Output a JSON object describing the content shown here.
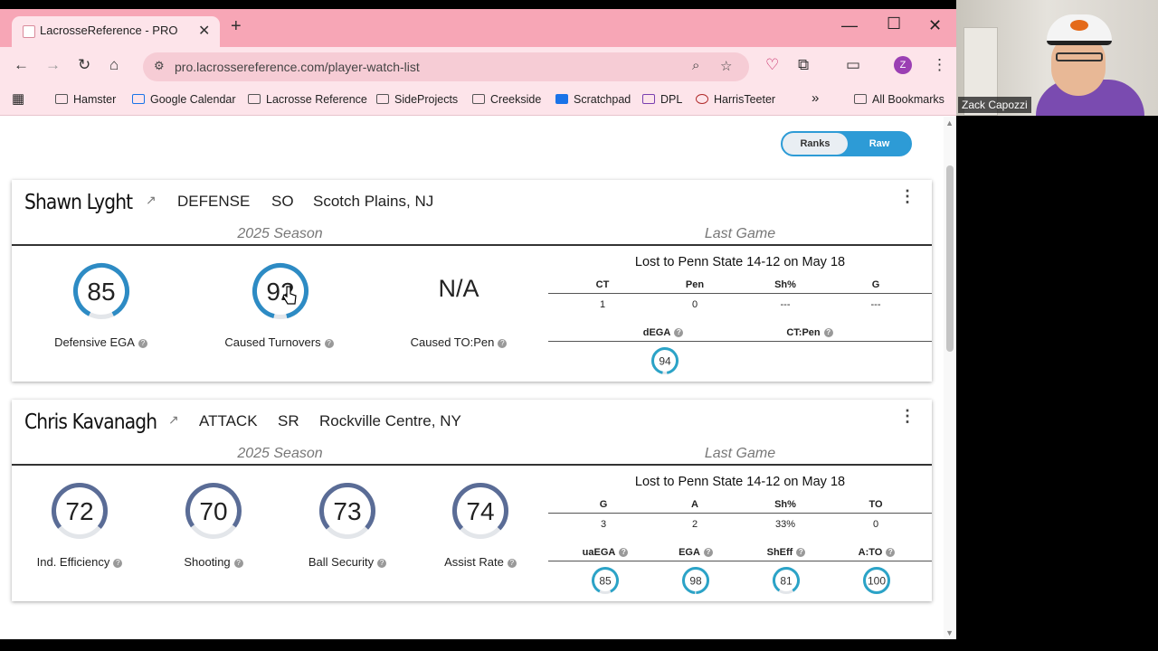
{
  "browser": {
    "tab_title": "LacrosseReference - PRO",
    "url": "pro.lacrossereference.com/player-watch-list",
    "profile_initial": "Z",
    "bookmarks": [
      "Hamster",
      "Google Calendar",
      "Lacrosse Reference",
      "SideProjects",
      "Creekside",
      "Scratchpad",
      "DPL",
      "HarrisTeeter"
    ],
    "all_bookmarks": "All Bookmarks",
    "more": "»"
  },
  "toggle": {
    "ranks": "Ranks",
    "raw": "Raw"
  },
  "players": [
    {
      "name": "Shawn Lyght",
      "position": "DEFENSE",
      "year": "SO",
      "hometown": "Scotch Plains, NJ",
      "season_label": "2025 Season",
      "last_game_label": "Last Game",
      "gauges": [
        {
          "label": "Defensive EGA",
          "value": "85",
          "pct": 0.85
        },
        {
          "label": "Caused Turnovers",
          "value": "92",
          "pct": 0.92
        },
        {
          "label": "Caused TO:Pen",
          "value": "N/A",
          "pct": null
        }
      ],
      "last_game_title": "Lost to Penn State 14-12 on May 18",
      "stat_heads": [
        "CT",
        "Pen",
        "Sh%",
        "G"
      ],
      "stat_vals": [
        "1",
        "0",
        "---",
        "---"
      ],
      "mini_heads": [
        "dEGA",
        "CT:Pen"
      ],
      "mini_gauges": [
        {
          "value": "94",
          "pct": 0.94
        }
      ]
    },
    {
      "name": "Chris Kavanagh",
      "position": "ATTACK",
      "year": "SR",
      "hometown": "Rockville Centre, NY",
      "season_label": "2025 Season",
      "last_game_label": "Last Game",
      "gauges": [
        {
          "label": "Ind. Efficiency",
          "value": "72",
          "pct": 0.72
        },
        {
          "label": "Shooting",
          "value": "70",
          "pct": 0.7
        },
        {
          "label": "Ball Security",
          "value": "73",
          "pct": 0.73
        },
        {
          "label": "Assist Rate",
          "value": "74",
          "pct": 0.74
        }
      ],
      "last_game_title": "Lost to Penn State 14-12 on May 18",
      "stat_heads": [
        "G",
        "A",
        "Sh%",
        "TO"
      ],
      "stat_vals": [
        "3",
        "2",
        "33%",
        "0"
      ],
      "mini_heads": [
        "uaEGA",
        "EGA",
        "ShEff",
        "A:TO"
      ],
      "mini_gauges": [
        {
          "value": "85",
          "pct": 0.85
        },
        {
          "value": "98",
          "pct": 0.98
        },
        {
          "value": "81",
          "pct": 0.81
        },
        {
          "value": "100",
          "pct": 1.0
        }
      ]
    }
  ],
  "webcam": {
    "name": "Zack Capozzi"
  },
  "colors": {
    "gauge_blue": "#2d8bc4",
    "gauge_slate": "#5a6c96",
    "mini_teal": "#2ba3c7",
    "tab_strip": "#f7a6b6"
  }
}
